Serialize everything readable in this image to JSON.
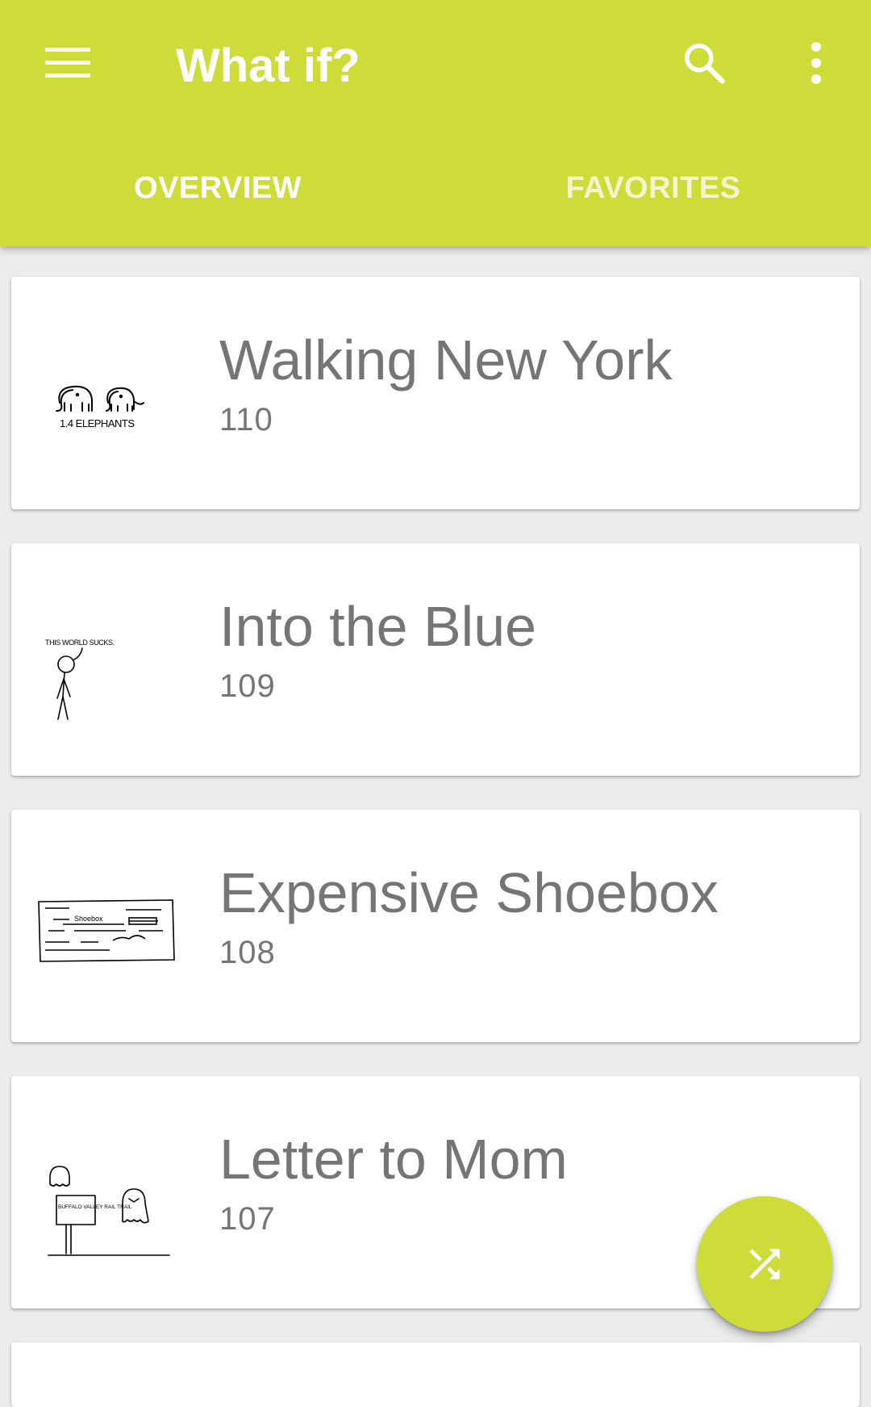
{
  "app": {
    "title": "What if?",
    "accent_color": "#cddc39",
    "icons": [
      "menu-icon",
      "search-icon",
      "more-vert-icon",
      "shuffle-icon"
    ]
  },
  "tabs": [
    {
      "label": "OVERVIEW",
      "selected": true
    },
    {
      "label": "FAVORITES",
      "selected": false
    }
  ],
  "articles": [
    {
      "title": "Walking New York",
      "number": "110",
      "thumb_text": "1.4 ELEPHANTS"
    },
    {
      "title": "Into the Blue",
      "number": "109",
      "thumb_text": "THIS WORLD SUCKS."
    },
    {
      "title": "Expensive Shoebox",
      "number": "108",
      "thumb_text": "Shoebox"
    },
    {
      "title": "Letter to Mom",
      "number": "107",
      "thumb_text": "BUFFALO VALLEY RAIL TRAIL"
    }
  ]
}
